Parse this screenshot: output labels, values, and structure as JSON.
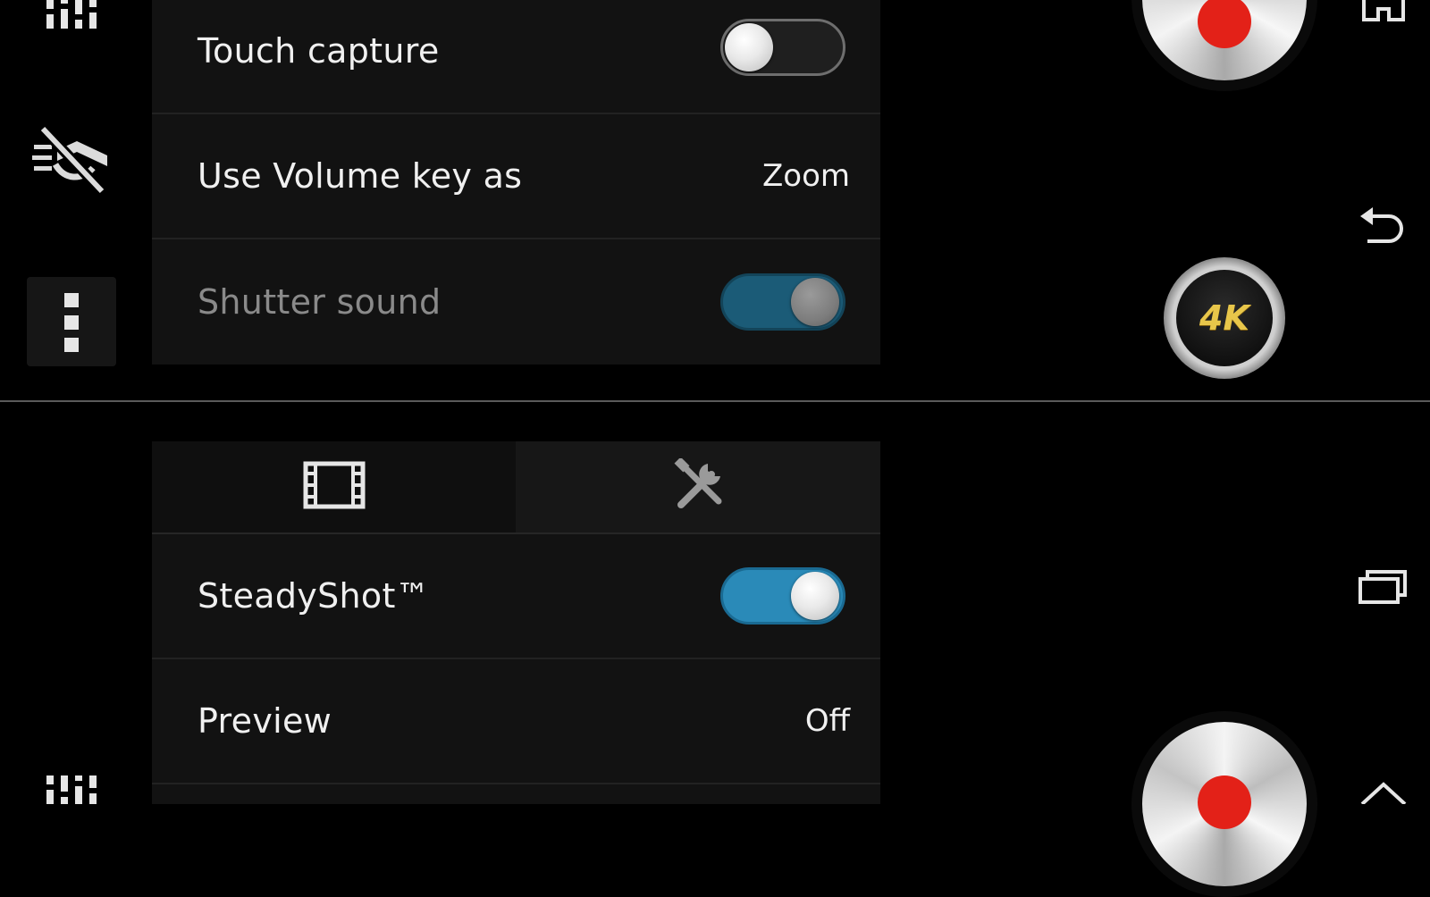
{
  "top_settings": {
    "rows": [
      {
        "label": "Touch capture",
        "toggle": "off"
      },
      {
        "label": "Use Volume key as",
        "value": "Zoom"
      },
      {
        "label": "Shutter sound",
        "toggle": "on",
        "dimmed": true
      }
    ]
  },
  "bottom_settings": {
    "tabs": [
      {
        "icon": "film-icon",
        "active": true
      },
      {
        "icon": "tools-icon",
        "active": false
      }
    ],
    "rows": [
      {
        "label": "SteadyShot™",
        "toggle": "on"
      },
      {
        "label": "Preview",
        "value": "Off"
      }
    ]
  },
  "right_controls": {
    "badge_text": "4K",
    "record_dot_color": "#e32118"
  },
  "left_controls": {
    "icons": [
      "manual-settings-icon",
      "flash-off-icon",
      "more-options-icon",
      "manual-settings-icon"
    ]
  },
  "nav_icons": [
    "home-icon",
    "back-icon",
    "recent-apps-icon",
    "up-chevron-icon"
  ],
  "colors": {
    "toggle_on": "#2a8ab8",
    "panel_bg": "#121212",
    "badge_text": "#e8c64a"
  }
}
